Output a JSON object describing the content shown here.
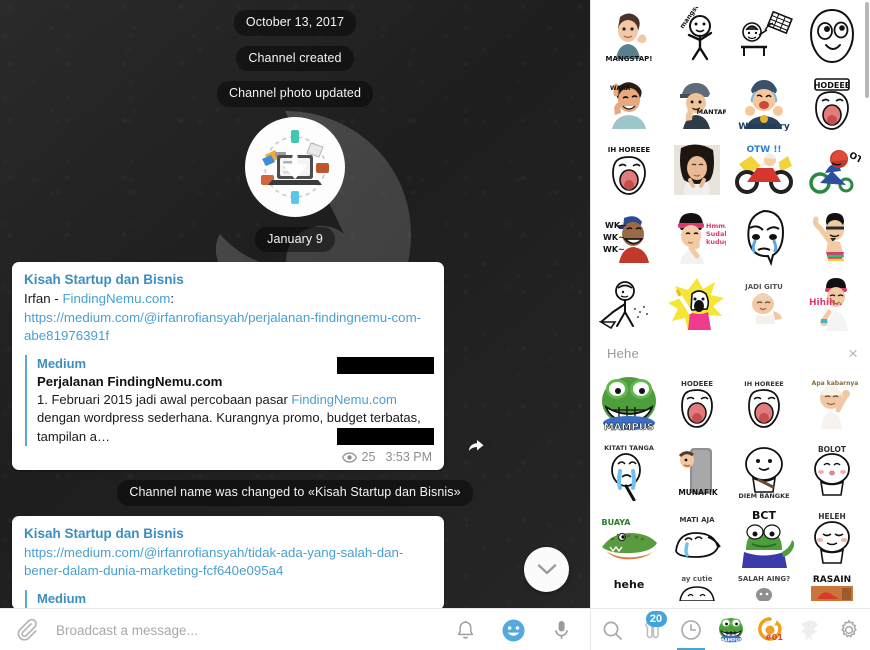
{
  "chat": {
    "service_messages": [
      {
        "id": "date-1",
        "text": "October 13, 2017"
      },
      {
        "id": "created",
        "text": "Channel created"
      },
      {
        "id": "photo",
        "text": "Channel photo updated"
      },
      {
        "id": "date-2",
        "text": "January 9"
      },
      {
        "id": "renamed",
        "text": "Channel name was changed to «Kisah Startup dan Bisnis»"
      }
    ],
    "channel_photo_alt": "laptop-download-icon",
    "messages": [
      {
        "author": "Kisah Startup dan Bisnis",
        "line_prefix": "Irfan - ",
        "line_link": "FindingNemu.com",
        "line_suffix": ":",
        "url": "https://medium.com/@irfanrofiansyah/perjalanan-findingnemu-com-abe81976391f",
        "preview": {
          "site": "Medium",
          "title": "Perjalanan FindingNemu.com",
          "desc_1": "1. Februari 2015 jadi awal percobaan pasar ",
          "desc_link": "FindingNemu.com",
          "desc_2": " dengan wordpress sederhana. Kurangnya promo, budget terbatas, tampilan a…"
        },
        "views": "25",
        "time": "3:53 PM"
      },
      {
        "author": "Kisah Startup dan Bisnis",
        "url": "https://medium.com/@irfanrofiansyah/tidak-ada-yang-salah-dan-bener-dalam-dunia-marketing-fcf640e095a4",
        "preview": {
          "site": "Medium"
        }
      }
    ],
    "forward_button_label": "forward",
    "scroll_down_label": "scroll to bottom"
  },
  "composer": {
    "attach_label": "Attach file",
    "placeholder": "Broadcast a message...",
    "value": "",
    "icons": [
      {
        "name": "notification-bell-icon",
        "label": "Notifications"
      },
      {
        "name": "emoji-smile-icon",
        "label": "Emoji"
      },
      {
        "name": "microphone-icon",
        "label": "Record voice"
      }
    ]
  },
  "sticker_panel": {
    "set_title": "Hehe",
    "close_label": "×",
    "rows_top": [
      [
        "MANGSTAP!",
        "mangstap-2",
        "throw-desk",
        "derp-face"
      ],
      [
        "waaa-point",
        "mantap-thumbsup",
        "WannaCry",
        "HODEEE"
      ],
      [
        "IH HOREEE",
        "girl-photo",
        "OTW!!",
        "otw-trike"
      ],
      [
        "WK WK WK",
        "Hmm Sudah kuduga",
        "cry-rage",
        "dance-guy"
      ],
      [
        "stick-sweep",
        "yellow-shout",
        "JADI GITU",
        "Hihih.."
      ]
    ],
    "rows_bottom": [
      [
        "MAMPUS",
        "HODEEE",
        "IH HOREEE",
        "Apa kabarnya"
      ],
      [
        "KITATI TANGA",
        "MUNAFIK",
        "DIEM BANGKE",
        "BOLOT"
      ],
      [
        "BUAYA",
        "MATI AJA",
        "BCT",
        "HELEH"
      ],
      [
        "hehe",
        "ay cutie",
        "SALAH AING?",
        "RASAIN"
      ]
    ]
  },
  "sticker_nav": {
    "items": [
      {
        "name": "search-icon",
        "label": "Search stickers",
        "badge": null,
        "active": false
      },
      {
        "name": "clip-stickers-icon",
        "label": "Favorites",
        "badge": "20",
        "active": false
      },
      {
        "name": "clock-recent-icon",
        "label": "Recent",
        "badge": null,
        "active": true
      },
      {
        "name": "sticker-set-mampus-icon",
        "label": "Hehe",
        "badge": null,
        "active": false
      },
      {
        "name": "sticker-set-boi-icon",
        "label": "#01",
        "badge": null,
        "active": false
      },
      {
        "name": "sticker-set-faded-icon",
        "label": "Set 3",
        "badge": null,
        "active": false
      },
      {
        "name": "gear-settings-icon",
        "label": "Settings",
        "badge": null,
        "active": false
      }
    ]
  },
  "colors": {
    "accent": "#4aa2d6",
    "link": "#4a9fd0",
    "bubble_bg": "#ffffff",
    "chat_bg": "#242424",
    "badge": "#42a3dd"
  }
}
